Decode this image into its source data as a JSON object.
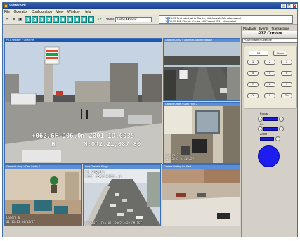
{
  "window": {
    "title": "ViewPoint",
    "icon": "app-icon"
  },
  "menu": [
    "File",
    "Operator",
    "Configuration",
    "View",
    "Window",
    "Help"
  ],
  "toolbar": {
    "view_label": "View",
    "view_value": "Video Monitor"
  },
  "alarms": [
    "10:26:55 Test Lab Hall to Caribe, MAXxess USA : Alarm alert",
    "10:26:55 PIR Clouds-Caribe, MAXxess USA : Alarm alert"
  ],
  "cameras": {
    "c1": {
      "title": "PTZ Register > OpenEye",
      "osd1": "+062.6F D06.0m Z001 ID:0035",
      "osd2": "H",
      "osd3": "N:042.21,087.80"
    },
    "c2": {
      "title": "Camera Dom2 < Camera Outside Entrance"
    },
    "c3": {
      "title": "Camera Office > Cam Front 2",
      "osd1": "Camera 1",
      "osd2": "01 13:03 04/12/27"
    },
    "c4": {
      "title": "Camera Lobby > Cam Lobby 3",
      "osd1": "Camera 6",
      "osd2": "01 13:03 04/12/27"
    },
    "c5": {
      "title": "Iowa Gaewille Bridge",
      "osd1": "NE VERNON",
      "osd2": "WEST FOREHOMES, N",
      "osd3": "Feb 08, 2007  3:22 PM PST",
      "osd4": "M WSDOT"
    },
    "c6": {
      "title": "Camera Parking Lot East"
    }
  },
  "panel": {
    "tabs": [
      "Playback",
      "Events",
      "Transactions",
      "PTZ"
    ],
    "active_tab": "PTZ",
    "title": "PTZ Control",
    "camera_select": "PCS Register > OpenEye",
    "display": "00",
    "home": "Home",
    "keys": [
      "1",
      "2",
      "3",
      "4",
      "5",
      "6",
      "7",
      "8",
      "9",
      "Clr",
      "0",
      "Go"
    ],
    "focus_label": "Focus",
    "iris_label": "Iris",
    "zoom_label": "Zoom",
    "minus": "-",
    "plus": "+"
  },
  "colors": {
    "accent": "#1e56b0",
    "joystick": "#1d1df0",
    "layout_button": "#2fc7c0"
  }
}
